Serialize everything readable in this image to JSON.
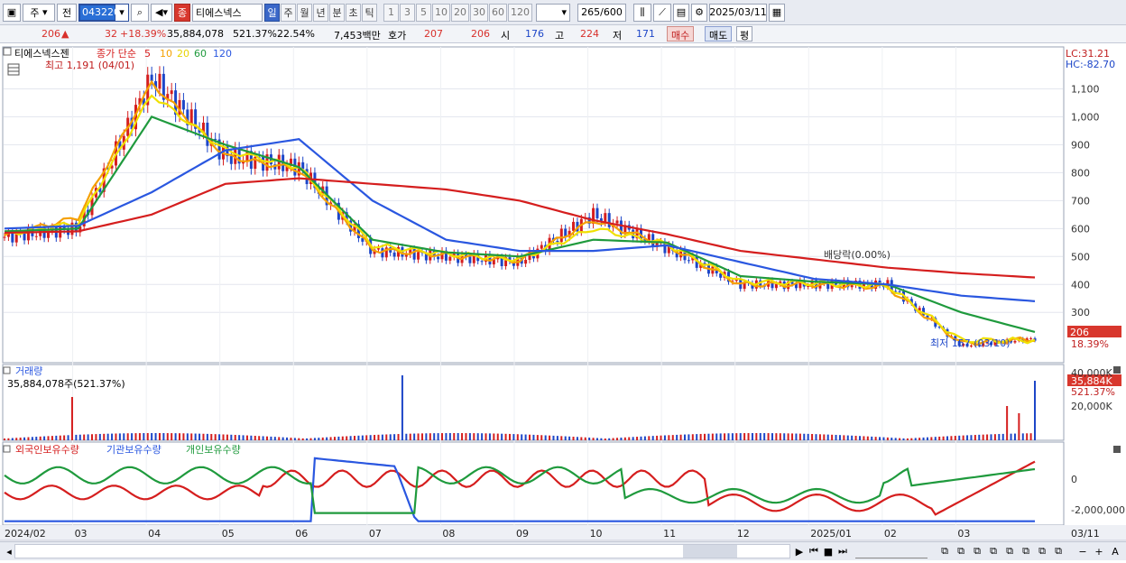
{
  "toolbar": {
    "period_select": "주",
    "prev_label": "전",
    "code": "043220",
    "stock_name": "티에스넥스",
    "red_tag": "종",
    "periods": [
      "일",
      "주",
      "월",
      "년",
      "분",
      "초",
      "틱"
    ],
    "active_period": "일",
    "intervals": [
      "1",
      "3",
      "5",
      "10",
      "20",
      "30",
      "60",
      "120"
    ],
    "count": "265",
    "count_max": "/600",
    "date": "2025/03/11"
  },
  "quote": {
    "price": "206",
    "change": "32",
    "change_pct": "+18.39%",
    "volume": "35,884,078",
    "volume_pct": "521.37%",
    "turnover": "22.54%",
    "amount": "7,453백만",
    "hoga_label": "호가",
    "ask": "207",
    "bid": "206",
    "open_label": "시",
    "open": "176",
    "high_label": "고",
    "high": "224",
    "low_label": "저",
    "low": "171",
    "buy_label": "매수",
    "sell_label": "매도",
    "avg_label": "평"
  },
  "price_panel": {
    "title": "티에스넥스젠",
    "legend_prefix": "종가 단순",
    "ma_labels": [
      "5",
      "10",
      "20",
      "60",
      "120"
    ],
    "ma_colors": [
      "#d51e1e",
      "#f5a000",
      "#f0e000",
      "#1f9a3d",
      "#2a57e0"
    ],
    "lc": "LC:31.21",
    "hc": "HC:-82.70",
    "high_note": "최고 1,191 (04/01)",
    "low_note": "최저 157 (03/10)",
    "div_note": "배당락(0.00%)",
    "last_price_tag": "206",
    "last_pct_tag": "18.39%",
    "y_ticks": [
      "1,100",
      "1,000",
      "900",
      "800",
      "700",
      "600",
      "500",
      "400",
      "300"
    ]
  },
  "volume_panel": {
    "title": "거래량",
    "value_note": "35,884,078주(521.37%)",
    "y_ticks": [
      "40,000K",
      "20,000K"
    ],
    "last_tag": "35,884K",
    "last_pct": "521.37%"
  },
  "holding_panel": {
    "legend": [
      "외국인보유수량",
      "기관보유수량",
      "개인보유수량"
    ],
    "colors": [
      "#d51e1e",
      "#2a57e0",
      "#1f9a3d"
    ],
    "y_ticks": [
      "0",
      "-2,000,000"
    ]
  },
  "x_axis": [
    "2024/02",
    "03",
    "04",
    "05",
    "06",
    "07",
    "08",
    "09",
    "10",
    "11",
    "12",
    "2025/01",
    "02",
    "03",
    "03/11"
  ],
  "chart_data": {
    "type": "line",
    "title": "티에스넥스젠",
    "x": [
      "2024/02",
      "03",
      "04",
      "05",
      "06",
      "07",
      "08",
      "09",
      "10",
      "11",
      "12",
      "2025/01",
      "02",
      "03",
      "03/11"
    ],
    "series": [
      {
        "name": "종가",
        "values": [
          570,
          600,
          1140,
          860,
          820,
          520,
          500,
          480,
          650,
          530,
          400,
          400,
          400,
          180,
          206
        ]
      },
      {
        "name": "5",
        "values": [
          575,
          640,
          1120,
          860,
          810,
          525,
          505,
          485,
          630,
          540,
          400,
          400,
          390,
          190,
          205
        ]
      },
      {
        "name": "10",
        "values": [
          580,
          620,
          1080,
          880,
          820,
          540,
          510,
          490,
          600,
          545,
          410,
          405,
          395,
          200,
          200
        ]
      },
      {
        "name": "20",
        "values": [
          590,
          600,
          1000,
          900,
          820,
          560,
          515,
          500,
          560,
          550,
          430,
          410,
          400,
          300,
          230
        ]
      },
      {
        "name": "60",
        "values": [
          600,
          610,
          730,
          880,
          920,
          700,
          560,
          520,
          520,
          540,
          480,
          420,
          400,
          360,
          340
        ]
      },
      {
        "name": "120",
        "values": [
          585,
          590,
          650,
          760,
          780,
          760,
          740,
          700,
          630,
          580,
          520,
          490,
          460,
          440,
          425
        ]
      }
    ],
    "ylim": [
      200,
      1191
    ],
    "ylabel": "",
    "xlabel": ""
  },
  "bottom": {
    "nav_icons": [
      "▶",
      "⏮",
      "■",
      "⏭"
    ],
    "right_icons": [
      "−",
      "+",
      "A"
    ]
  }
}
